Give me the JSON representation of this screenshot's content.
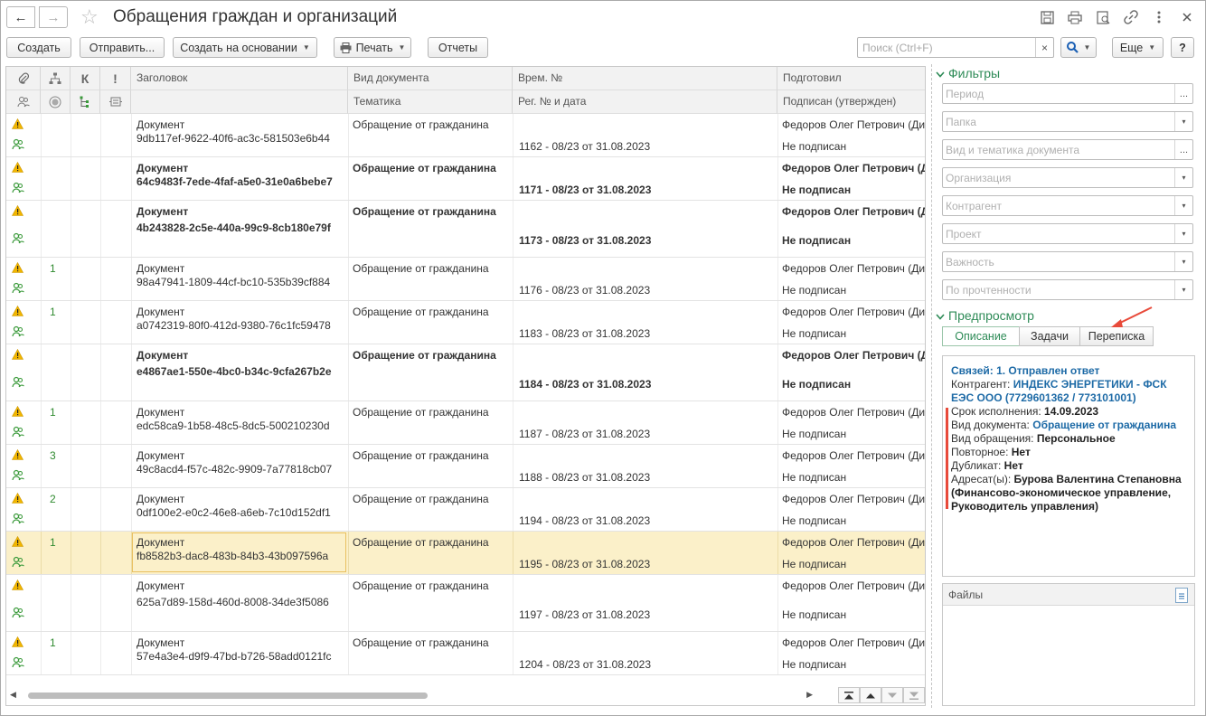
{
  "window": {
    "title": "Обращения граждан и организаций",
    "nav_back": "←",
    "nav_forward": "→",
    "star": "☆",
    "icons": [
      "save-icon",
      "print-icon",
      "preview-icon",
      "link-icon",
      "more-icon",
      "close-icon"
    ]
  },
  "toolbar": {
    "create": "Создать",
    "send": "Отправить...",
    "create_based": "Создать на основании",
    "print": "Печать",
    "reports": "Отчеты",
    "search_placeholder": "Поиск (Ctrl+F)",
    "search_clear": "×",
    "more": "Еще",
    "help": "?"
  },
  "table": {
    "headers": {
      "title": "Заголовок",
      "doc_type": "Вид документа",
      "topic": "Тематика",
      "temp_no": "Врем. №",
      "reg_no": "Рег. № и дата",
      "prepared": "Подготовил",
      "signed": "Подписан (утвержден)",
      "k": "К",
      "excl": "!"
    },
    "rows": [
      {
        "bold": false,
        "selected": false,
        "num": "",
        "title1": "Документ",
        "title2": "9db117ef-9622-40f6-ac3c-581503e6b44",
        "type": "Обращение от гражданина",
        "reg": "1162 - 08/23 от 31.08.2023",
        "prep": "Федоров Олег Петрович (Ди",
        "signed": "Не подписан"
      },
      {
        "bold": true,
        "selected": false,
        "num": "",
        "title1": "Документ",
        "title2": "64c9483f-7ede-4faf-a5e0-31e0a6bebe7",
        "type": "Обращение от гражданина",
        "reg": "1171 - 08/23 от 31.08.2023",
        "prep": "Федоров Олег Петрович (Д",
        "signed": "Не подписан"
      },
      {
        "bold": true,
        "selected": false,
        "num": "",
        "title1": "Документ",
        "title2": "4b243828-2c5e-440a-99c9-8cb180e79f",
        "type": "Обращение от гражданина",
        "reg": "1173 - 08/23 от 31.08.2023",
        "prep": "Федоров Олег Петрович (Д",
        "signed": "Не подписан"
      },
      {
        "bold": false,
        "selected": false,
        "num": "1",
        "title1": "Документ",
        "title2": "98a47941-1809-44cf-bc10-535b39cf884",
        "type": "Обращение от гражданина",
        "reg": "1176 - 08/23 от 31.08.2023",
        "prep": "Федоров Олег Петрович (Ди",
        "signed": "Не подписан"
      },
      {
        "bold": false,
        "selected": false,
        "num": "1",
        "title1": "Документ",
        "title2": "a0742319-80f0-412d-9380-76c1fc59478",
        "type": "Обращение от гражданина",
        "reg": "1183 - 08/23 от 31.08.2023",
        "prep": "Федоров Олег Петрович (Ди",
        "signed": "Не подписан"
      },
      {
        "bold": true,
        "selected": false,
        "num": "",
        "title1": "Документ",
        "title2": "e4867ae1-550e-4bc0-b34c-9cfa267b2e",
        "type": "Обращение от гражданина",
        "reg": "1184 - 08/23 от 31.08.2023",
        "prep": "Федоров Олег Петрович (Д",
        "signed": "Не подписан"
      },
      {
        "bold": false,
        "selected": false,
        "num": "1",
        "title1": "Документ",
        "title2": "edc58ca9-1b58-48c5-8dc5-500210230d",
        "type": "Обращение от гражданина",
        "reg": "1187 - 08/23 от 31.08.2023",
        "prep": "Федоров Олег Петрович (Ди",
        "signed": "Не подписан"
      },
      {
        "bold": false,
        "selected": false,
        "num": "3",
        "title1": "Документ",
        "title2": "49c8acd4-f57c-482c-9909-7a77818cb07",
        "type": "Обращение от гражданина",
        "reg": "1188 - 08/23 от 31.08.2023",
        "prep": "Федоров Олег Петрович (Ди",
        "signed": "Не подписан"
      },
      {
        "bold": false,
        "selected": false,
        "num": "2",
        "title1": "Документ",
        "title2": "0df100e2-e0c2-46e8-a6eb-7c10d152df1",
        "type": "Обращение от гражданина",
        "reg": "1194 - 08/23 от 31.08.2023",
        "prep": "Федоров Олег Петрович (Ди",
        "signed": "Не подписан"
      },
      {
        "bold": false,
        "selected": true,
        "num": "1",
        "title1": "Документ",
        "title2": "fb8582b3-dac8-483b-84b3-43b097596a",
        "type": "Обращение от гражданина",
        "reg": "1195 - 08/23 от 31.08.2023",
        "prep": "Федоров Олег Петрович (Ди",
        "signed": "Не подписан"
      },
      {
        "bold": false,
        "selected": false,
        "num": "",
        "title1": "Документ",
        "title2": "625a7d89-158d-460d-8008-34de3f5086",
        "type": "Обращение от гражданина",
        "reg": "1197 - 08/23 от 31.08.2023",
        "prep": "Федоров Олег Петрович (Ди",
        "signed": "Не подписан"
      },
      {
        "bold": false,
        "selected": false,
        "num": "1",
        "title1": "Документ",
        "title2": "57e4a3e4-d9f9-47bd-b726-58add0121fc",
        "type": "Обращение от гражданина",
        "reg": "1204 - 08/23 от 31.08.2023",
        "prep": "Федоров Олег Петрович (Ди",
        "signed": "Не подписан"
      }
    ]
  },
  "filters": {
    "section": "Фильтры",
    "fields": [
      {
        "placeholder": "Период",
        "button": "..."
      },
      {
        "placeholder": "Папка",
        "button": "▾"
      },
      {
        "placeholder": "Вид и тематика документа",
        "button": "..."
      },
      {
        "placeholder": "Организация",
        "button": "▾"
      },
      {
        "placeholder": "Контрагент",
        "button": "▾"
      },
      {
        "placeholder": "Проект",
        "button": "▾"
      },
      {
        "placeholder": "Важность",
        "button": "▾"
      },
      {
        "placeholder": "По прочтенности",
        "button": "▾"
      }
    ]
  },
  "preview": {
    "section": "Предпросмотр",
    "tabs": [
      "Описание",
      "Задачи",
      "Переписка"
    ],
    "links": "Связей: 1. Отправлен ответ",
    "contractor_label": "Контрагент: ",
    "contractor_value": "ИНДЕКС ЭНЕРГЕТИКИ - ФСК ЕЭС ООО (7729601362 / 773101001)",
    "deadline_label": "Срок исполнения: ",
    "deadline_value": "14.09.2023",
    "doc_type_label": "Вид документа: ",
    "doc_type_value": "Обращение от гражданина",
    "appeal_type_label": "Вид обращения: ",
    "appeal_type_value": "Персональное",
    "repeat_label": "Повторное: ",
    "repeat_value": "Нет",
    "duplicate_label": "Дубликат: ",
    "duplicate_value": "Нет",
    "addressee_label": "Адресат(ы): ",
    "addressee_value": "Бурова Валентина Степановна (Финансово-экономическое управление, Руководитель управления)"
  },
  "files": {
    "header": "Файлы"
  },
  "colors": {
    "accent": "#2e8b57",
    "link": "#1d6aa6",
    "selected_row": "#fbf0c9",
    "warning": "#e0a800",
    "annotation": "#e84a3a"
  }
}
